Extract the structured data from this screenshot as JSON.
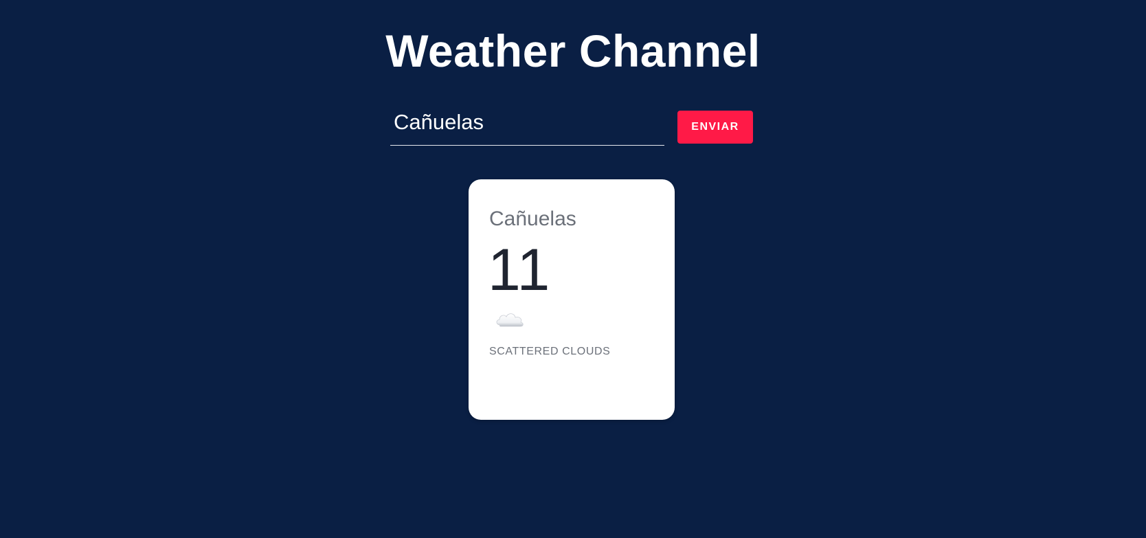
{
  "header": {
    "title": "Weather Channel"
  },
  "search": {
    "value": "Cañuelas",
    "placeholder": ""
  },
  "send_button": {
    "label": "ENVIAR"
  },
  "weather_card": {
    "city": "Cañuelas",
    "temperature": "11",
    "icon": "cloud-icon",
    "description": "SCATTERED CLOUDS"
  },
  "colors": {
    "background": "#0a1f44",
    "accent": "#ff1a47",
    "card": "#ffffff"
  }
}
